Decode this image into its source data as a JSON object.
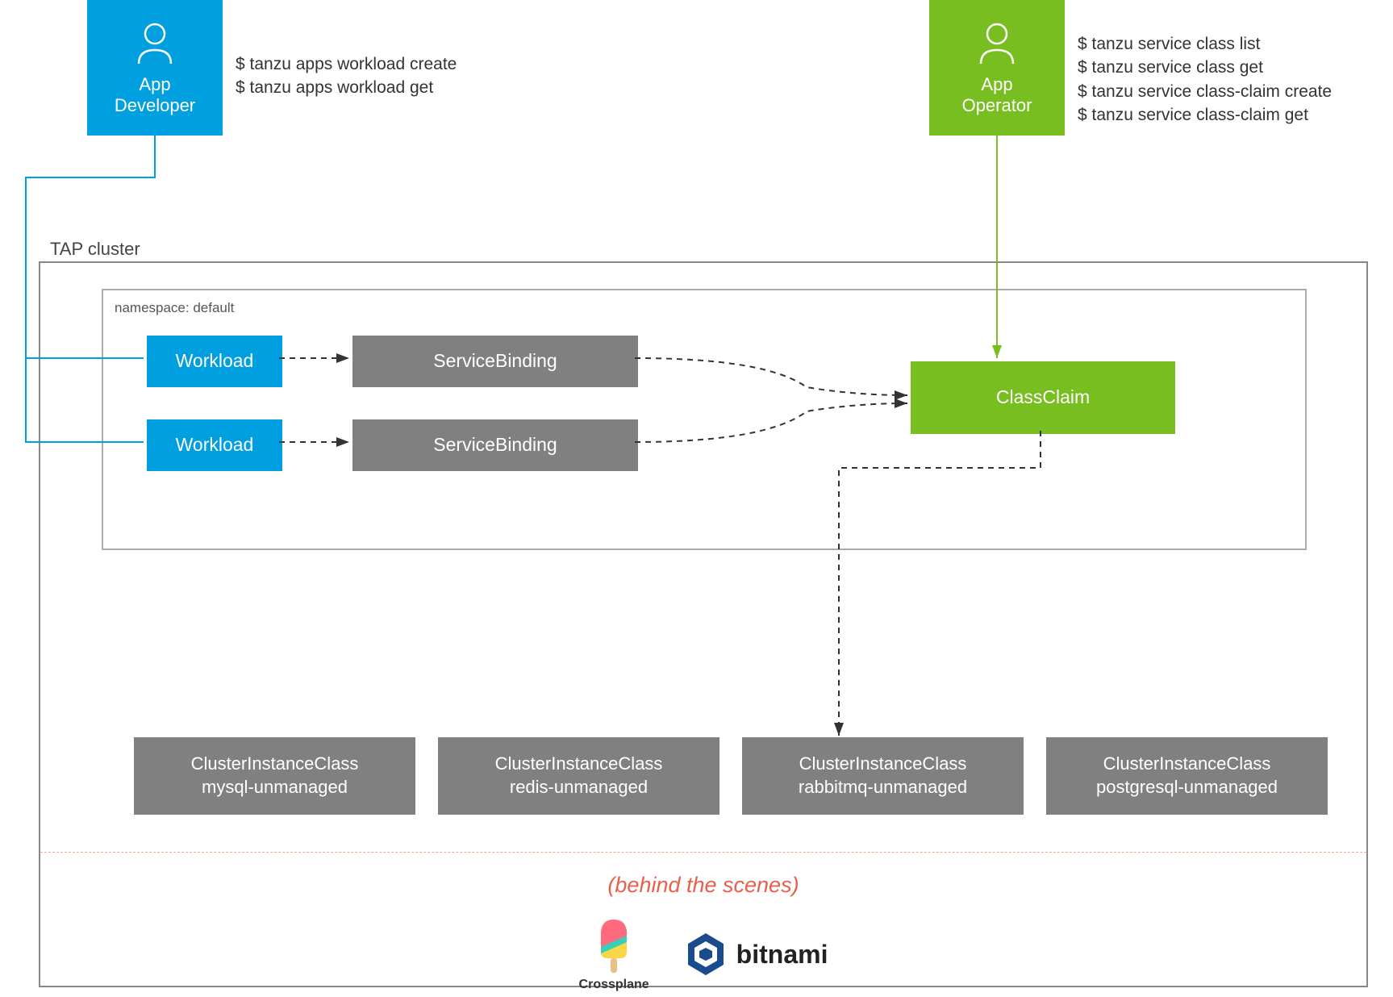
{
  "personas": {
    "developer": {
      "label": "App\nDeveloper"
    },
    "operator": {
      "label": "App\nOperator"
    }
  },
  "commands": {
    "developer": [
      "$ tanzu apps workload create",
      "$ tanzu apps workload get"
    ],
    "operator": [
      "$ tanzu service class list",
      "$ tanzu service class get",
      "$ tanzu service class-claim create",
      "$ tanzu service class-claim get"
    ]
  },
  "cluster": {
    "label": "TAP cluster"
  },
  "namespace": {
    "label": "namespace: default"
  },
  "nodes": {
    "workload1": "Workload",
    "workload2": "Workload",
    "servicebinding1": "ServiceBinding",
    "servicebinding2": "ServiceBinding",
    "classclaim": "ClassClaim"
  },
  "cluster_instance_classes": [
    {
      "title": "ClusterInstanceClass",
      "sub": "mysql-unmanaged"
    },
    {
      "title": "ClusterInstanceClass",
      "sub": "redis-unmanaged"
    },
    {
      "title": "ClusterInstanceClass",
      "sub": "rabbitmq-unmanaged"
    },
    {
      "title": "ClusterInstanceClass",
      "sub": "postgresql-unmanaged"
    }
  ],
  "behind_scenes": {
    "label": "(behind the scenes)"
  },
  "logos": {
    "crossplane": "Crossplane",
    "bitnami": "bitnami"
  }
}
